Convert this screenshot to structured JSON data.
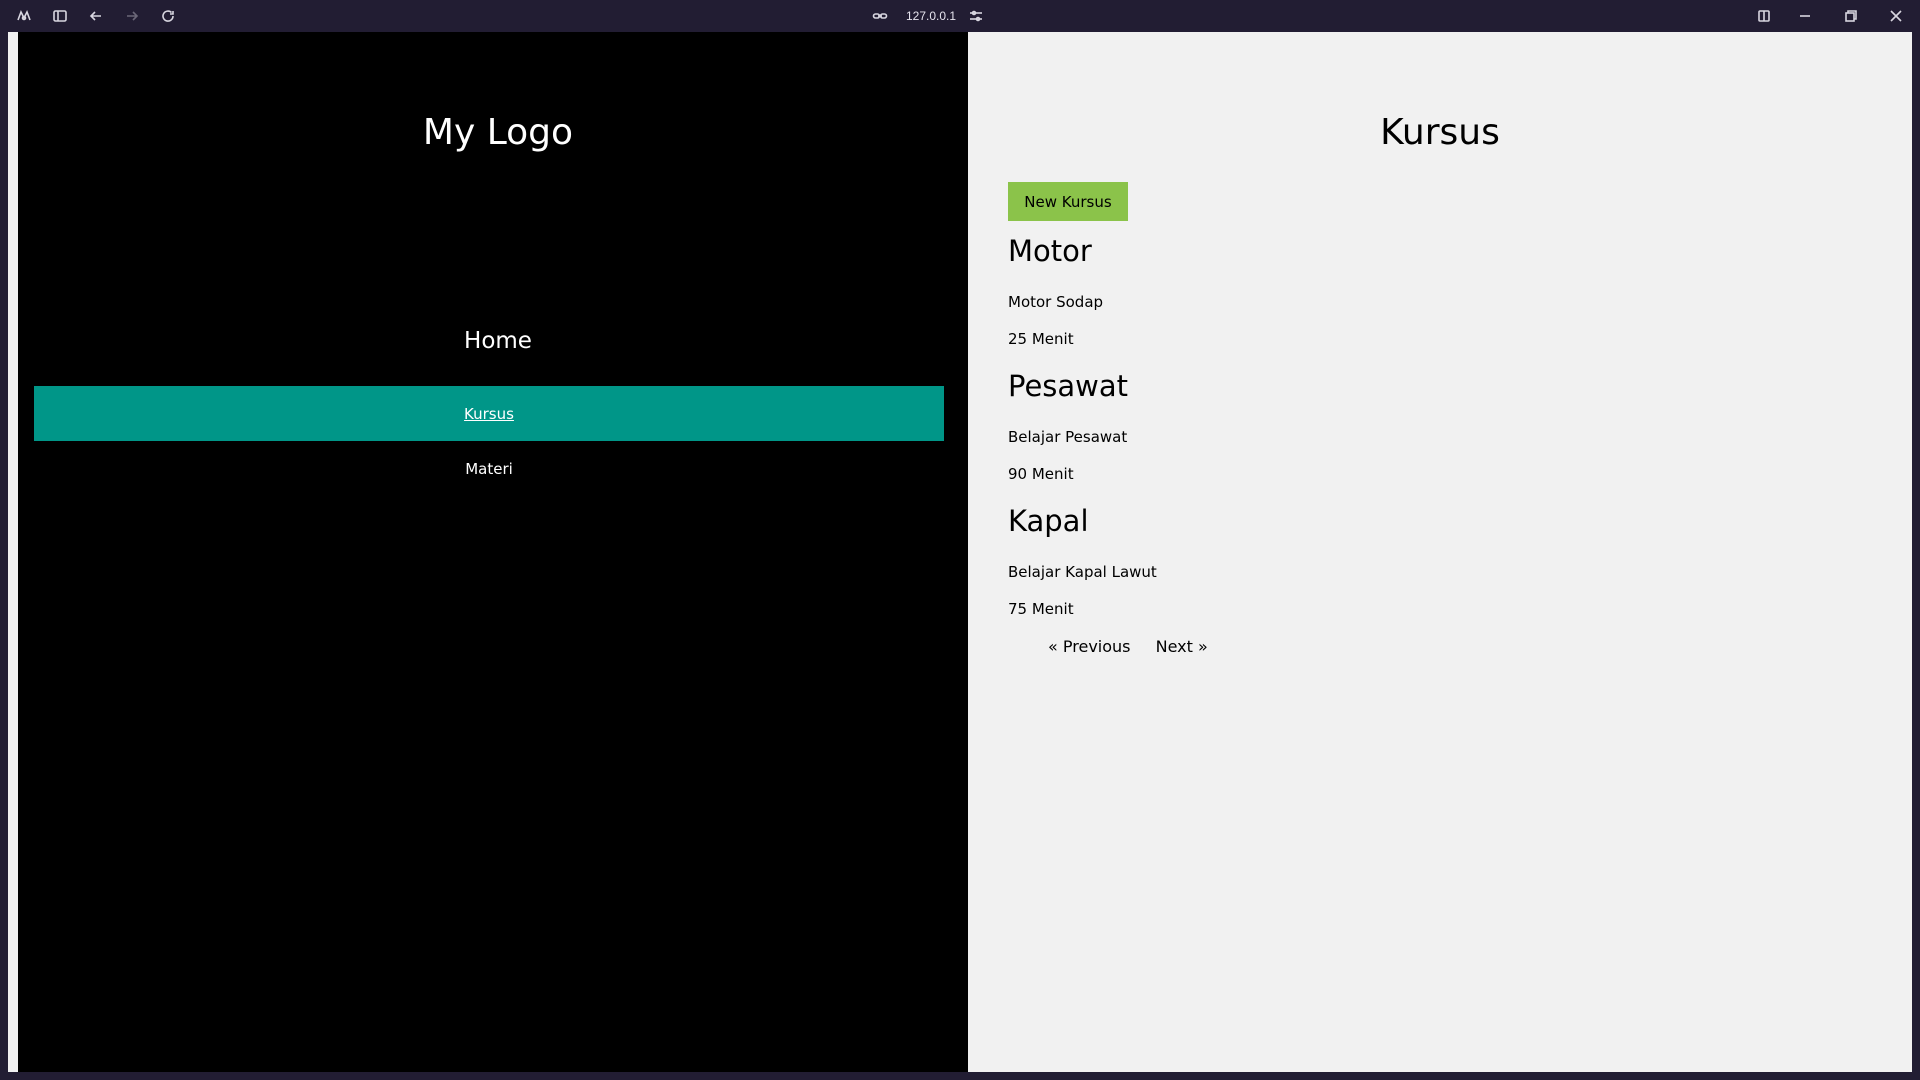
{
  "browser": {
    "url": "127.0.0.1"
  },
  "sidebar": {
    "logo": "My Logo",
    "home": "Home",
    "items": [
      {
        "label": "Kursus",
        "active": true
      },
      {
        "label": "Materi",
        "active": false
      }
    ]
  },
  "main": {
    "title": "Kursus",
    "new_button": "New Kursus",
    "courses": [
      {
        "title": "Motor",
        "description": "Motor Sodap",
        "duration": "25 Menit"
      },
      {
        "title": "Pesawat",
        "description": "Belajar Pesawat",
        "duration": "90 Menit"
      },
      {
        "title": "Kapal",
        "description": "Belajar Kapal Lawut",
        "duration": "75 Menit"
      }
    ],
    "pagination": {
      "previous": "« Previous",
      "next": "Next »"
    }
  },
  "colors": {
    "sidebar_bg": "#000000",
    "active_item": "#009688",
    "new_button": "#8bc34a",
    "main_bg": "#f1f1f1"
  }
}
